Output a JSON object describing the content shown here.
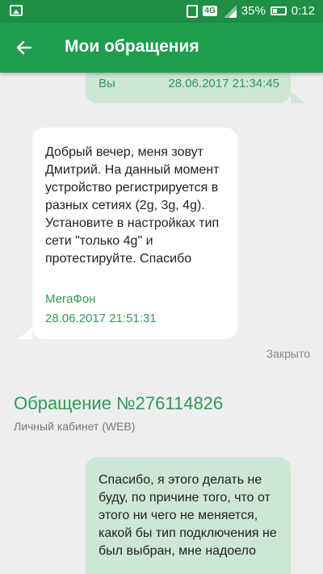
{
  "status_bar": {
    "network": "4G",
    "battery_percent": "35%",
    "time": "0:12"
  },
  "app_bar": {
    "title": "Мои обращения"
  },
  "messages": [
    {
      "direction": "outgoing",
      "author": "Вы",
      "timestamp": "28.06.2017 21:34:45"
    },
    {
      "direction": "incoming",
      "text": "Добрый вечер, меня зовут Дмитрий. На данный момент устройство регистрируется в разных сетиях (2g, 3g, 4g). Установите в настройках тип сети \"только 4g\"  и протестируйте. Спасибо",
      "author": "МегаФон",
      "timestamp": "28.06.2017 21:51:31"
    }
  ],
  "ticket_status": "Закрыто",
  "ticket": {
    "title": "Обращение №276114826",
    "source": "Личный кабинет (WEB)",
    "message": {
      "direction": "outgoing",
      "text": "Спасибо, я этого делать не буду, по причине того, что от этого ни чего не меняется, какой бы тип подключения не был выбран, мне надоело"
    }
  },
  "colors": {
    "status_bar": "#1f8f46",
    "app_bar": "#1f9d4e",
    "accent_green": "#2f9a57",
    "outgoing_bubble": "#cde6d5",
    "incoming_bubble": "#ffffff",
    "background": "#eeeeee"
  },
  "icons": [
    "image-icon",
    "vibrate-icon",
    "signal-icon",
    "battery-icon",
    "back-arrow-icon"
  ]
}
